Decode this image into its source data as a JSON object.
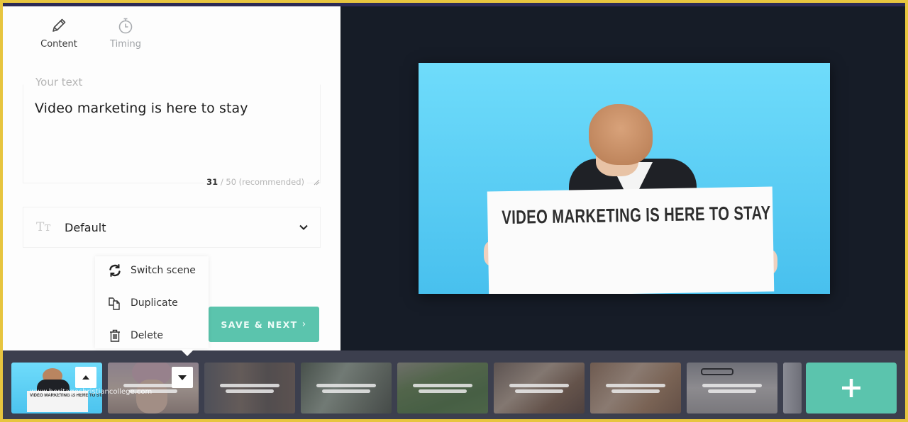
{
  "tabs": [
    {
      "label": "Content",
      "icon": "pencil-icon",
      "active": true
    },
    {
      "label": "Timing",
      "icon": "stopwatch-icon",
      "active": false
    }
  ],
  "text_field": {
    "label": "Your text",
    "value": "Video marketing is here to stay",
    "char_count": "31",
    "char_limit": "/ 50 (recommended)"
  },
  "font_select": {
    "icon": "text-size-icon",
    "icon_glyph": "Tт",
    "value": "Default"
  },
  "save_button": {
    "label": "SAVE & NEXT",
    "chevron": "›"
  },
  "context_menu": {
    "items": [
      {
        "label": "Switch scene",
        "icon": "refresh-icon"
      },
      {
        "label": "Duplicate",
        "icon": "copy-icon"
      },
      {
        "label": "Delete",
        "icon": "trash-icon"
      }
    ]
  },
  "preview": {
    "sign_text": "VIDEO MARKETING IS HERE TO STAY",
    "background_color": "#5ccff5"
  },
  "timeline": {
    "scenes": [
      {
        "type": "current",
        "caption": "VIDEO MARKETING IS HERE TO STAY",
        "button": "move-up"
      },
      {
        "type": "placeholder",
        "button": "move-down"
      },
      {
        "type": "placeholder"
      },
      {
        "type": "placeholder"
      },
      {
        "type": "placeholder"
      },
      {
        "type": "placeholder"
      },
      {
        "type": "placeholder"
      },
      {
        "type": "placeholder"
      },
      {
        "type": "partial"
      }
    ],
    "add_label": "+"
  },
  "watermark": "www.heritagechristiancollege.com",
  "colors": {
    "accent": "#5bc4ad",
    "frame_border": "#e7c53f",
    "canvas_bg": "#161c27",
    "timeline_bg": "#3c3f4e"
  }
}
